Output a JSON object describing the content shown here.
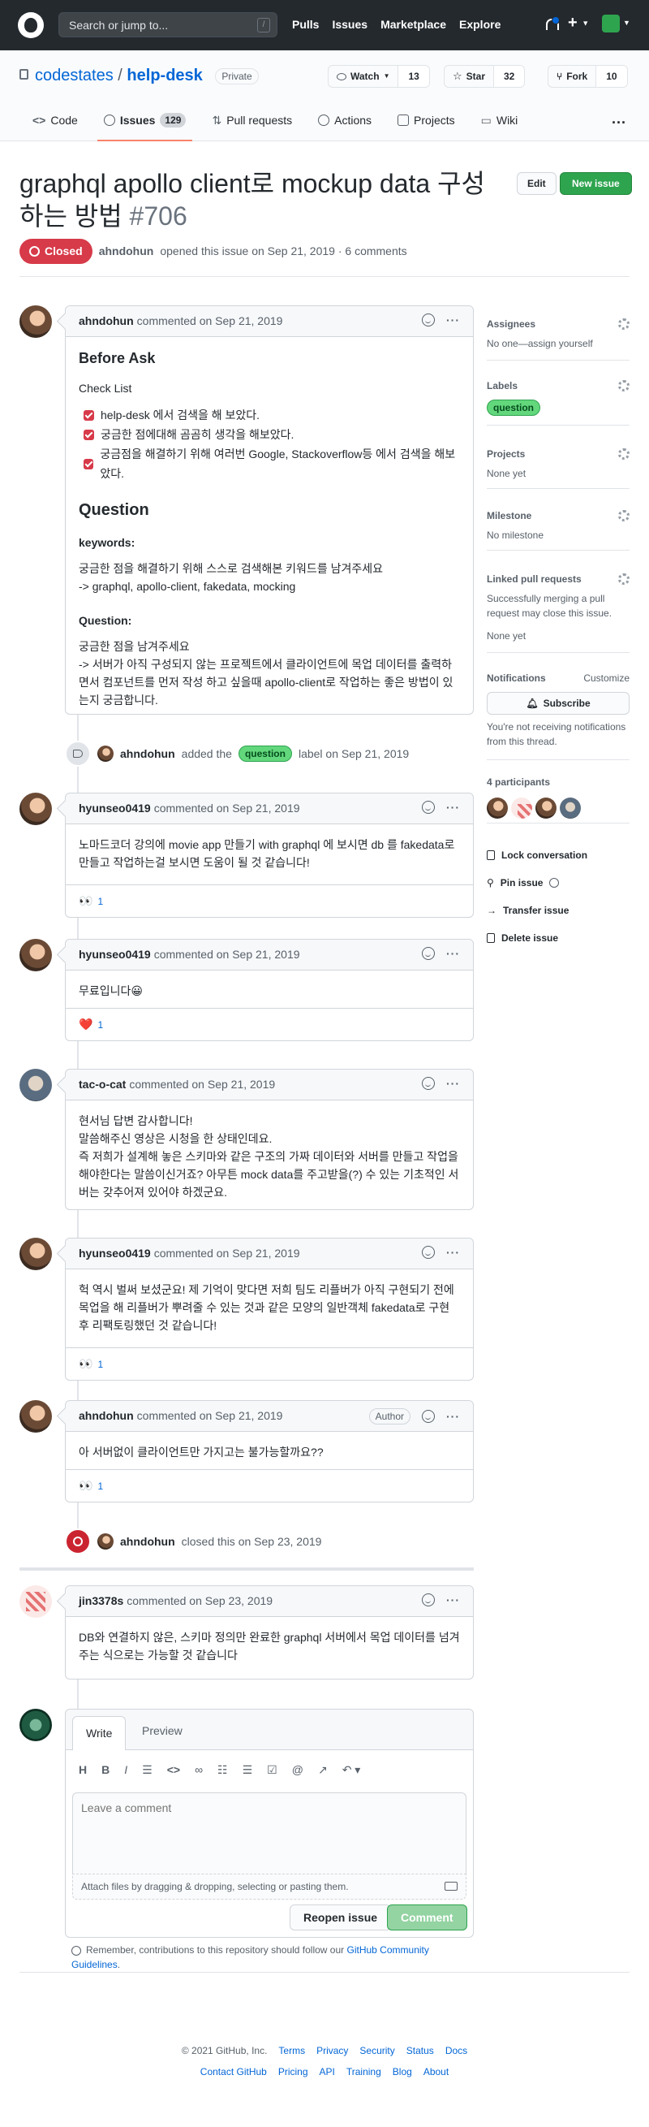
{
  "header": {
    "search_placeholder": "Search or jump to...",
    "slash_key": "/",
    "nav": [
      "Pulls",
      "Issues",
      "Marketplace",
      "Explore"
    ]
  },
  "repo": {
    "owner": "codestates",
    "separator": "/",
    "name": "help-desk",
    "visibility": "Private",
    "watch_label": "Watch",
    "watch_count": "13",
    "star_label": "Star",
    "star_count": "32",
    "fork_label": "Fork",
    "fork_count": "10",
    "tabs": [
      {
        "label": "Code"
      },
      {
        "label": "Issues",
        "count": "129"
      },
      {
        "label": "Pull requests"
      },
      {
        "label": "Actions"
      },
      {
        "label": "Projects"
      },
      {
        "label": "Wiki"
      }
    ]
  },
  "issue": {
    "title": "graphql apollo client로 mockup data 구성하는 방법",
    "number": "#706",
    "edit_label": "Edit",
    "new_label": "New issue",
    "state": "Closed",
    "author": "ahndohun",
    "meta_text": "opened this issue on Sep 21, 2019 · 6 comments"
  },
  "first_comment": {
    "author": "ahndohun",
    "time": "commented on Sep 21, 2019",
    "heading": "Before Ask",
    "checklist_title": "Check List",
    "checklist": [
      "help-desk 에서 검색을 해 보았다.",
      "궁금한 점에대해 곰곰히 생각을 해보았다.",
      "궁금점을 해결하기 위해 여러번 Google, Stackoverflow등 에서 검색을 해보았다."
    ],
    "question_heading": "Question",
    "keywords_label": "keywords:",
    "keywords_line1": "궁금한 점을 해결하기 위해 스스로 검색해본 키워드를 남겨주세요",
    "keywords_line2": "-> graphql, apollo-client, fakedata, mocking",
    "question_label": "Question:",
    "question_line1": "궁금한 점을 남겨주세요",
    "question_line2": "-> 서버가 아직 구성되지 않는 프로젝트에서 클라이언트에 목업 데이터를 출력하면서 컴포넌트를 먼저 작성 하고 싶을때 apollo-client로 작업하는 좋은 방법이 있는지 궁금합니다."
  },
  "label_event": {
    "actor": "ahndohun",
    "pre": "added the",
    "label": "question",
    "post": "label on Sep 21, 2019"
  },
  "comments": [
    {
      "author": "hyunseo0419",
      "time": "commented on Sep 21, 2019",
      "body": "노마드코더 강의에 movie app 만들기 with graphql 에 보시면 db 를 fakedata로 만들고 작업하는걸 보시면 도움이 될 것 같습니다!",
      "reaction": "👀",
      "reaction_count": "1"
    },
    {
      "author": "hyunseo0419",
      "time": "commented on Sep 21, 2019",
      "body": "무료입니다😀",
      "reaction": "❤️",
      "reaction_count": "1"
    },
    {
      "author": "tac-o-cat",
      "time": "commented on Sep 21, 2019",
      "body_lines": [
        "현서님 답변 감사합니다!",
        "말씀해주신 영상은 시청을 한 상태인데요.",
        "즉 저희가 설계해 놓은 스키마와 같은 구조의 가짜 데이터와 서버를 만들고 작업을 해야한다는 말씀이신거죠? 아무튼 mock data를 주고받을(?) 수 있는 기초적인 서버는 갖추어져 있어야 하겠군요."
      ]
    },
    {
      "author": "hyunseo0419",
      "time": "commented on Sep 21, 2019",
      "body": "헉 역시 벌써 보셨군요! 제 기억이 맞다면 저희 팀도 리플버가 아직 구현되기 전에 목업을 해 리플버가 뿌려줄 수 있는 것과 같은 모양의 일반객체 fakedata로 구현 후 리팩토링했던 것 같습니다!",
      "reaction": "👀",
      "reaction_count": "1"
    },
    {
      "author": "ahndohun",
      "time": "commented on Sep 21, 2019",
      "tag": "Author",
      "body": "아 서버없이 클라이언트만 가지고는 불가능할까요??",
      "reaction": "👀",
      "reaction_count": "1"
    }
  ],
  "closed_event": {
    "actor": "ahndohun",
    "text": "closed this on Sep 23, 2019"
  },
  "last_comment": {
    "author": "jin3378s",
    "time": "commented on Sep 23, 2019",
    "body": "DB와 연결하지 않은, 스키마 정의만 완료한 graphql 서버에서 목업 데이터를 넘겨주는 식으로는 가능할 것 같습니다"
  },
  "composer": {
    "write_tab": "Write",
    "preview_tab": "Preview",
    "placeholder": "Leave a comment",
    "attach_text": "Attach files by dragging & dropping, selecting or pasting them.",
    "reopen_label": "Reopen issue",
    "comment_label": "Comment",
    "guideline_pre": "Remember, contributions to this repository should follow our",
    "guideline_link": "GitHub Community Guidelines",
    "guideline_post": "."
  },
  "sidebar": {
    "assignees_title": "Assignees",
    "assignees_value": "No one—assign yourself",
    "labels_title": "Labels",
    "labels_value": "question",
    "projects_title": "Projects",
    "projects_value": "None yet",
    "milestone_title": "Milestone",
    "milestone_value": "No milestone",
    "linked_title": "Linked pull requests",
    "linked_desc": "Successfully merging a pull request may close this issue.",
    "linked_value": "None yet",
    "notifications_title": "Notifications",
    "customize": "Customize",
    "subscribe": "Subscribe",
    "notif_desc": "You're not receiving notifications from this thread.",
    "participants_title": "4 participants",
    "lock": "Lock conversation",
    "pin": "Pin issue",
    "transfer": "Transfer issue",
    "delete": "Delete issue"
  },
  "footer": {
    "copyright": "© 2021 GitHub, Inc.",
    "row1": [
      "Terms",
      "Privacy",
      "Security",
      "Status",
      "Docs"
    ],
    "row2": [
      "Contact GitHub",
      "Pricing",
      "API",
      "Training",
      "Blog",
      "About"
    ]
  },
  "colors": {
    "header_bg": "#24292e",
    "closed_badge": "#d73a49",
    "new_issue": "#2ea44f",
    "label_question": "#63d77c",
    "link": "#0366d6"
  }
}
